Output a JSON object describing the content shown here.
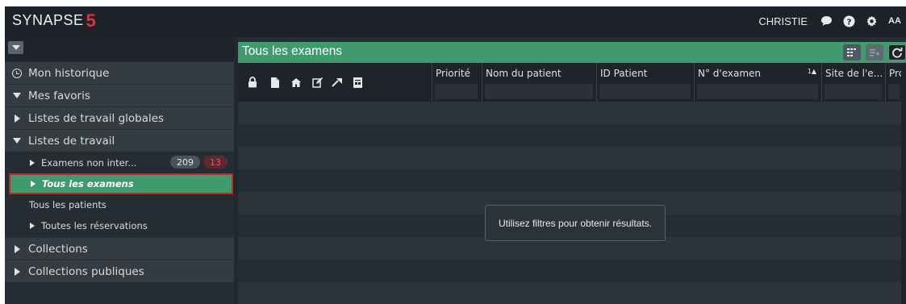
{
  "app": {
    "logo_text": "SYNAPSE",
    "logo_mark": "5",
    "user_name": "CHRISTIE",
    "top_icons": [
      "chat-icon",
      "help-icon",
      "settings-icon",
      "font-size-icon"
    ],
    "font_size_label": "AA"
  },
  "sidebar": {
    "history_label": "Mon historique",
    "favorites_label": "Mes favoris",
    "global_worklists_label": "Listes de travail globales",
    "worklists_label": "Listes de travail",
    "worklists_items": [
      {
        "label": "Examens non inter...",
        "count": "209",
        "alert_count": "13"
      },
      {
        "label": "Tous les examens"
      },
      {
        "label": "Tous les patients"
      },
      {
        "label": "Toutes les réservations"
      }
    ],
    "collections_label": "Collections",
    "public_collections_label": "Collections publiques"
  },
  "main": {
    "title": "Tous les examens",
    "columns": [
      "Priorité",
      "Nom du patient",
      "ID Patient",
      "N° d'examen",
      "Site de l'e...",
      "Pro"
    ],
    "sort_indicator": "1▲",
    "header_icons": [
      "lock-icon",
      "document-icon",
      "home-icon",
      "edit-icon",
      "pin-icon",
      "report-icon"
    ],
    "empty_message": "Utilisez filtres pour obtenir résultats."
  },
  "colors": {
    "accent_green": "#3f9b6e",
    "selection_border": "#c4262e",
    "alert_red": "#ff4a55",
    "background": "#22292e"
  }
}
